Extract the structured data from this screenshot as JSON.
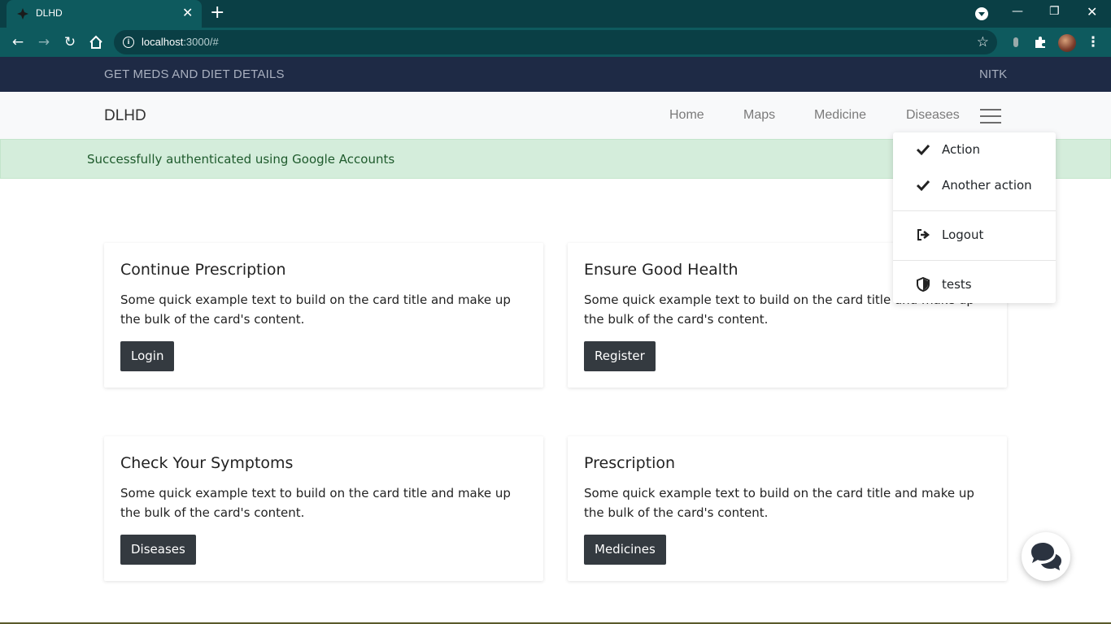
{
  "browser": {
    "tab_title": "DLHD",
    "url_host": "localhost",
    "url_rest": ":3000/#"
  },
  "page": {
    "topstrip": {
      "left": "GET MEDS AND DIET DETAILS",
      "right": "NITK"
    },
    "navbar": {
      "brand": "DLHD",
      "links": [
        "Home",
        "Maps",
        "Medicine",
        "Diseases"
      ]
    },
    "alert": {
      "text": "Successfully authenticated using Google Accounts"
    },
    "dropdown": {
      "items": [
        {
          "label": "Action",
          "icon": "check-icon"
        },
        {
          "label": "Another action",
          "icon": "check-icon"
        },
        {
          "label": "Logout",
          "icon": "sign-out-icon"
        },
        {
          "label": "tests",
          "icon": "shield-icon"
        }
      ]
    },
    "cards": [
      {
        "title": "Continue Prescription",
        "text": "Some quick example text to build on the card title and make up the bulk of the card's content.",
        "button": "Login"
      },
      {
        "title": "Ensure Good Health",
        "text": "Some quick example text to build on the card title and make up the bulk of the card's content.",
        "button": "Register"
      },
      {
        "title": "Check Your Symptoms",
        "text": "Some quick example text to build on the card title and make up the bulk of the card's content.",
        "button": "Diseases"
      },
      {
        "title": "Prescription",
        "text": "Some quick example text to build on the card title and make up the bulk of the card's content.",
        "button": "Medicines"
      }
    ]
  },
  "colors": {
    "chrome_dark": "#0a3f45",
    "chrome": "#0e5a5e",
    "topstrip": "#1e2a45",
    "alert_bg": "#d4eddb",
    "button_dark": "#343a40"
  }
}
